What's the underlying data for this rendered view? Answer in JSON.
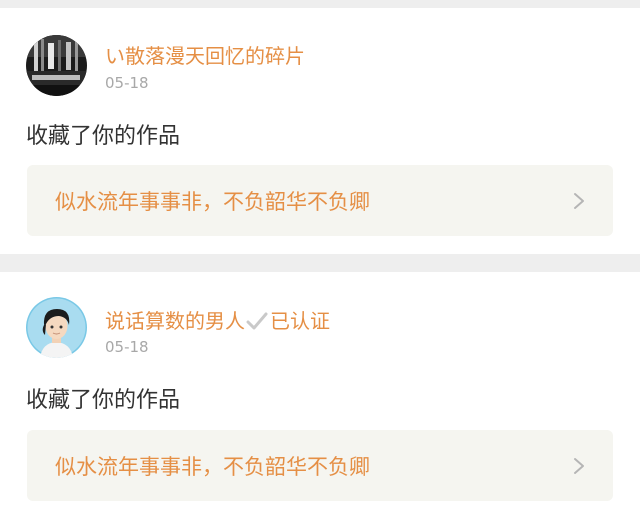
{
  "feed": {
    "items": [
      {
        "username": "い散落漫天回忆的碎片",
        "verified_label": "",
        "date": "05-18",
        "action": "收藏了你的作品",
        "work_title": "似水流年事事非，不负韶华不负卿",
        "avatar_icon": "dark-photo-avatar-icon"
      },
      {
        "username": "说话算数的男人",
        "verified_label": "已认证",
        "date": "05-18",
        "action": "收藏了你的作品",
        "work_title": "似水流年事事非，不负韶华不负卿",
        "avatar_icon": "cartoon-boy-avatar-icon"
      }
    ]
  },
  "colors": {
    "accent": "#e58f45",
    "text": "#333333",
    "muted": "#a8a8a8",
    "link_background": "#f5f5f0",
    "page_background": "#eeeeee"
  }
}
